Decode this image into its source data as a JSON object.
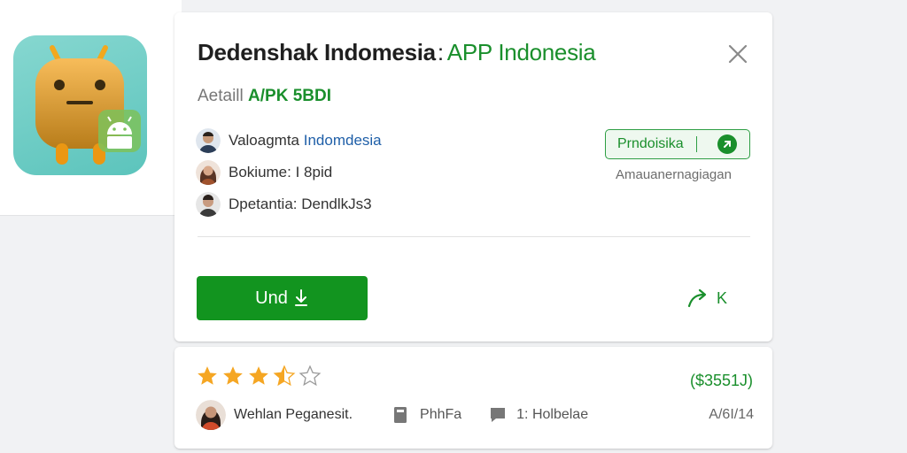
{
  "app": {
    "title": "Dedenshak Indomesia",
    "title_separator": ":",
    "title_suffix": "APP Indonesia",
    "subtitle_prefix": "Aetaill",
    "subtitle_highlight": "A/PK 5BDI",
    "icon_name": "android-robot-icon"
  },
  "info": [
    {
      "label": "Valoagmta",
      "value": "Indomdesia",
      "value_is_link": true
    },
    {
      "label": "Bokiume:",
      "value": "I 8pid",
      "value_is_link": false
    },
    {
      "label": "Dpetantia:",
      "value": "DendlkJs3",
      "value_is_link": false
    }
  ],
  "tag": {
    "label": "Prndoisika",
    "caption": "Amauanernagiagan"
  },
  "actions": {
    "install_label": "Und",
    "share_label": "K"
  },
  "rating": {
    "stars_filled": 3,
    "stars_half": 1,
    "stars_total": 5,
    "price": "($3551J)"
  },
  "reviewer": {
    "name": "Wehlan Peganesit.",
    "meta1": "PhhFa",
    "meta2": "1: Holbelae",
    "version": "A/6I/14"
  },
  "colors": {
    "accent_green": "#12941f",
    "text_green": "#1a8f2c",
    "link_blue": "#1f5fa8",
    "star_gold": "#f5a623",
    "icon_bg": "#5cc4bc",
    "robot_body": "#f5a623"
  }
}
